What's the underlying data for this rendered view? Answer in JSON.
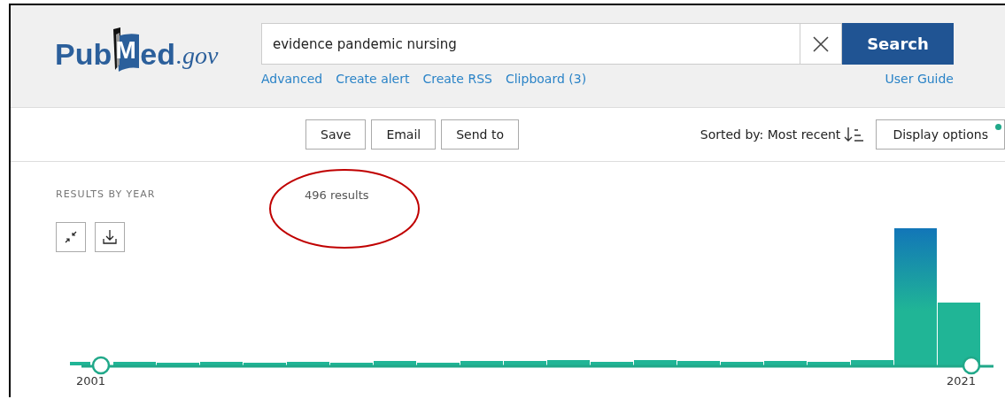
{
  "header": {
    "logo": {
      "before": "Pub",
      "book_letter": "M",
      "after": "ed",
      "domain": ".gov"
    },
    "search": {
      "value": "evidence pandemic nursing",
      "button": "Search"
    },
    "links": [
      "Advanced",
      "Create alert",
      "Create RSS",
      "Clipboard (3)"
    ],
    "help_link": "User Guide"
  },
  "toolbar": {
    "buttons": [
      "Save",
      "Email",
      "Send to"
    ],
    "sort_label": "Sorted by: Most recent",
    "display_options": {
      "label": "Display options",
      "indicator": true
    }
  },
  "results_by_year": {
    "title": "RESULTS BY YEAR",
    "count": "496 results",
    "count_annotation": {
      "kind": "ellipse"
    },
    "range_start": "2001",
    "range_end": "2021"
  }
}
